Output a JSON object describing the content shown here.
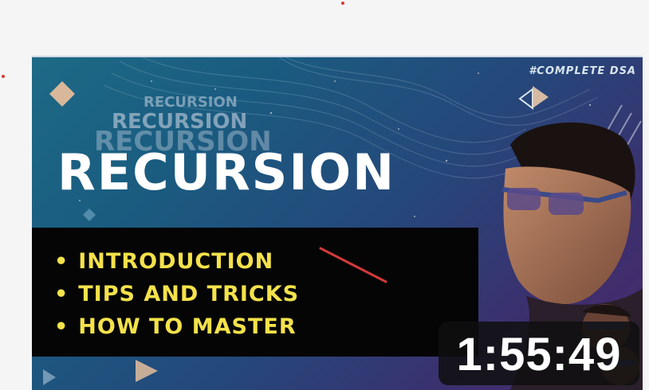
{
  "thumbnail": {
    "tag": "#COMPLETE DSA",
    "ghost_titles": [
      "RECURSION",
      "RECURSION",
      "RECURSION"
    ],
    "title": "RECURSION",
    "bullets": [
      {
        "dot": "•",
        "text": "INTRODUCTION"
      },
      {
        "dot": "•",
        "text": "TIPS AND TRICKS"
      },
      {
        "dot": "•",
        "text": "HOW TO MASTER"
      }
    ],
    "duration": "1:55:49"
  },
  "colors": {
    "background": "#f5f5f5",
    "bullet_text": "#f4e24a",
    "title_text": "#ffffff",
    "annotation": "#d23a3a",
    "duration_badge": "#0f0f0f"
  },
  "icons": [
    "diamond-shape-icon",
    "triangle-shape-icon",
    "person-portrait"
  ]
}
